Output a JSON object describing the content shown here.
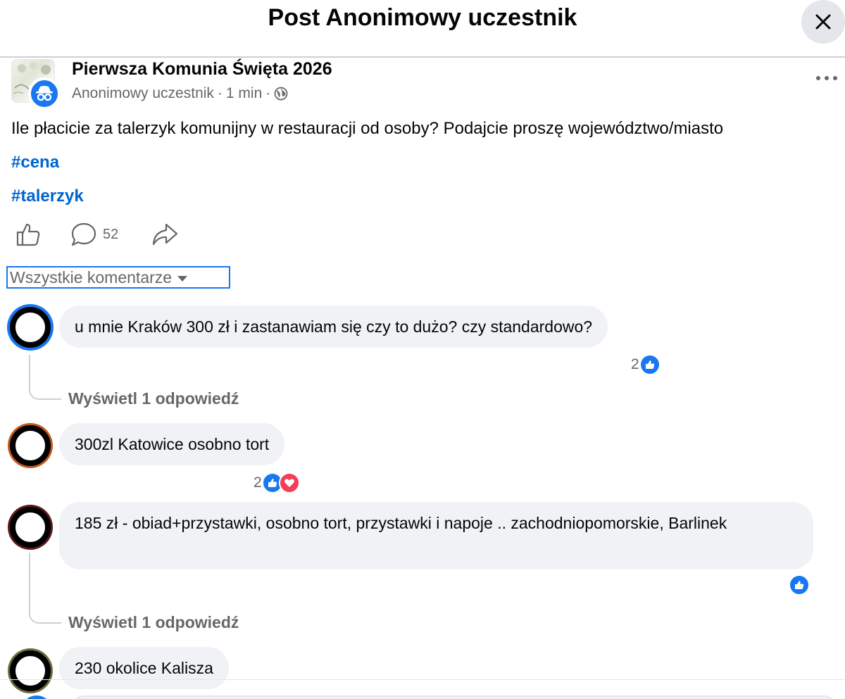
{
  "header": {
    "title": "Post Anonimowy uczestnik"
  },
  "post": {
    "group_name": "Pierwsza Komunia Święta 2026",
    "author": "Anonimowy uczestnik",
    "time": "1 min",
    "separator": "·",
    "text": "Ile płacicie za talerzyk komunijny w restauracji od osoby? Podajcie proszę województwo/miasto",
    "hashtags": [
      "#cena",
      "#talerzyk"
    ],
    "comment_count": "52"
  },
  "comments_filter": {
    "label": "Wszystkie komentarze"
  },
  "comments": [
    {
      "text": "u mnie Kraków 300 zł i zastanawiam się czy to dużo? czy standardowo?",
      "reaction_count": "2",
      "reactions": [
        "like"
      ],
      "reply_link": "Wyświetl 1 odpowiedź"
    },
    {
      "text": "300zl Katowice osobno tort",
      "reaction_count": "2",
      "reactions": [
        "like",
        "love"
      ]
    },
    {
      "text": "185 zł - obiad+przystawki, osobno tort, przystawki i napoje .. zachodniopomorskie, Barlinek",
      "reaction_count": "",
      "reactions": [
        "like"
      ],
      "reply_link": "Wyświetl 1 odpowiedź"
    },
    {
      "text": "230 okolice Kalisza"
    }
  ],
  "colors": {
    "accent": "#1877f2",
    "link": "#0064d1",
    "secondary_text": "#65676b",
    "bubble": "#f0f2f5",
    "love": "#f33e58"
  },
  "icons": [
    "close-icon",
    "anonymous-icon",
    "more-icon",
    "globe-icon",
    "like-icon",
    "comment-icon",
    "share-icon",
    "caret-down-icon"
  ]
}
